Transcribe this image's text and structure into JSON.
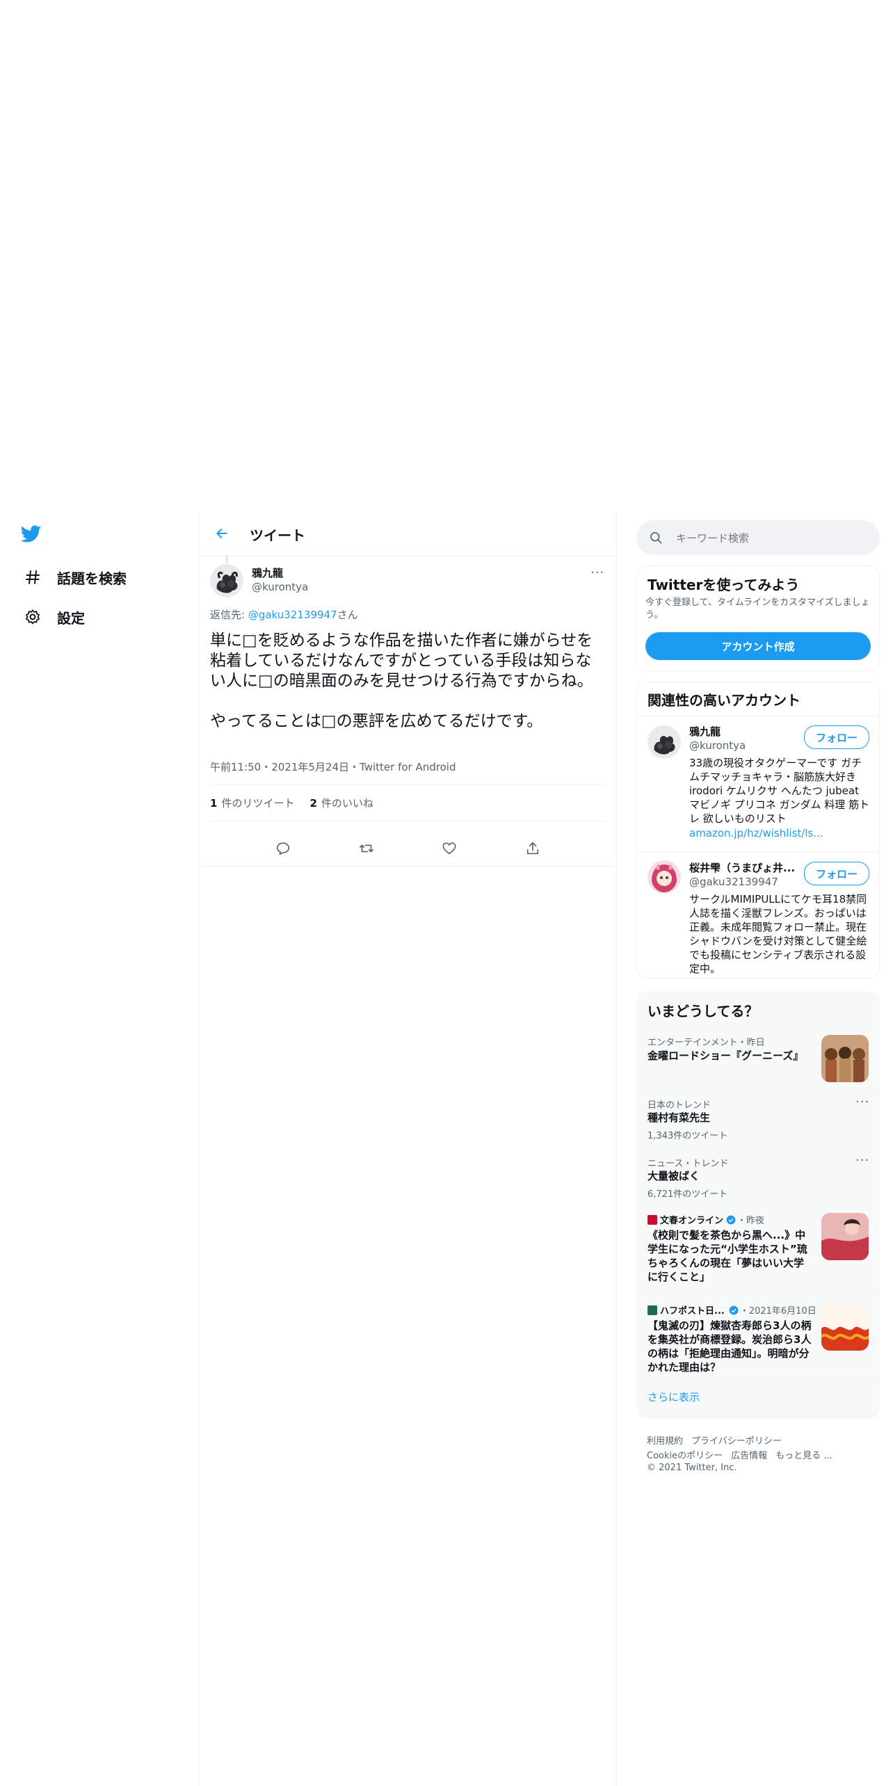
{
  "nav": {
    "items": [
      {
        "label": "話題を検索",
        "icon": "hashtag-icon"
      },
      {
        "label": "設定",
        "icon": "gear-icon"
      }
    ]
  },
  "header": {
    "title": "ツイート"
  },
  "tweet": {
    "author_name": "鴉九龍",
    "author_handle": "@kurontya",
    "reply_prefix": "返信先: ",
    "reply_handle": "@gaku32139947",
    "reply_suffix": "さん",
    "text": "単に□を貶めるような作品を描いた作者に嫌がらせを粘着しているだけなんですがとっている手段は知らない人に□の暗黒面のみを見せつける行為ですからね。\n\nやってることは□の悪評を広めてるだけです。",
    "meta": "午前11:50・2021年5月24日・Twitter for Android",
    "retweet_count": "1",
    "retweet_label": "件のリツイート",
    "like_count": "2",
    "like_label": "件のいいね"
  },
  "search": {
    "placeholder": "キーワード検索"
  },
  "signup": {
    "title": "Twitterを使ってみよう",
    "subtitle": "今すぐ登録して、タイムラインをカスタマイズしましょう。",
    "button": "アカウント作成"
  },
  "related": {
    "title": "関連性の高いアカウント",
    "follow_label": "フォロー",
    "accounts": [
      {
        "name": "鴉九龍",
        "handle": "@kurontya",
        "bio": "33歳の現役オタクゲーマーです ガチムチマッチョキャラ・脳筋族大好き irodori ケムリクサ へんたつ jubeat マビノギ プリコネ ガンダム 料理 筋トレ 欲しいものリスト",
        "link": "amazon.jp/hz/wishlist/ls..."
      },
      {
        "name": "桜井雫（うまぴょ井...",
        "handle": "@gaku32139947",
        "bio": "サークルMIMIPULLにてケモ耳18禁同人誌を描く淫獣フレンズ。おっぱいは正義。未成年閲覧フォロー禁止。現在シャドウバンを受け対策として健全絵でも投稿にセンシティブ表示される設定中。"
      }
    ]
  },
  "trends": {
    "title": "いまどうしてる？",
    "items": [
      {
        "category": "エンターテインメント・昨日",
        "title": "金曜ロードショー『グーニーズ』"
      },
      {
        "category": "日本のトレンド",
        "title": "種村有菜先生",
        "count": "1,343件のツイート"
      },
      {
        "category": "ニュース・トレンド",
        "title": "大量被ばく",
        "count": "6,721件のツイート"
      },
      {
        "source": "文春オンライン",
        "time": "・昨夜",
        "title": "《校則で髪を茶色から黒へ...》中学生になった元“小学生ホスト”琉ちゃろくんの現在「夢はいい大学に行くこと」"
      },
      {
        "source": "ハフポスト日...",
        "time": "・2021年6月10日",
        "title": "【鬼滅の刃】煉獄杏寿郎ら3人の柄を集英社が商標登録。炭治郎ら3人の柄は「拒絶理由通知」。明暗が分かれた理由は？"
      }
    ],
    "show_more": "さらに表示"
  },
  "footer": {
    "row1": [
      "利用規約",
      "プライバシーポリシー"
    ],
    "row2": [
      "Cookieのポリシー",
      "広告情報",
      "もっと見る ..."
    ],
    "copyright": "© 2021 Twitter, Inc."
  },
  "colors": {
    "accent": "#1d9bf0",
    "text": "#0f1419",
    "secondary": "#536471",
    "border": "#eff3f4"
  }
}
